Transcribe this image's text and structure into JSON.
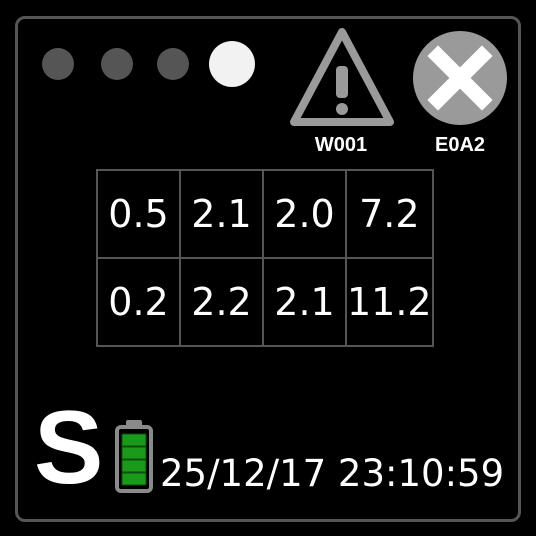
{
  "indicators": {
    "leds": [
      {
        "name": "led-1",
        "state": "off"
      },
      {
        "name": "led-2",
        "state": "off"
      },
      {
        "name": "led-3",
        "state": "off"
      },
      {
        "name": "led-4",
        "state": "on"
      }
    ],
    "colors": {
      "on": "#f2f2f2",
      "off": "#555555"
    }
  },
  "alerts": {
    "warning": {
      "icon": "warning-triangle-icon",
      "code": "W001"
    },
    "error": {
      "icon": "error-x-icon",
      "code": "E0A2"
    }
  },
  "readings": {
    "rows": [
      [
        "0.5",
        "2.1",
        "2.0",
        "7.2"
      ],
      [
        "0.2",
        "2.2",
        "2.1",
        "11.2"
      ]
    ]
  },
  "status": {
    "mode": "S",
    "battery": {
      "icon": "battery-icon",
      "level_bars": 4,
      "max_bars": 4,
      "color": "#1a9a1a"
    },
    "datetime": "25/12/17 23:10:59"
  }
}
